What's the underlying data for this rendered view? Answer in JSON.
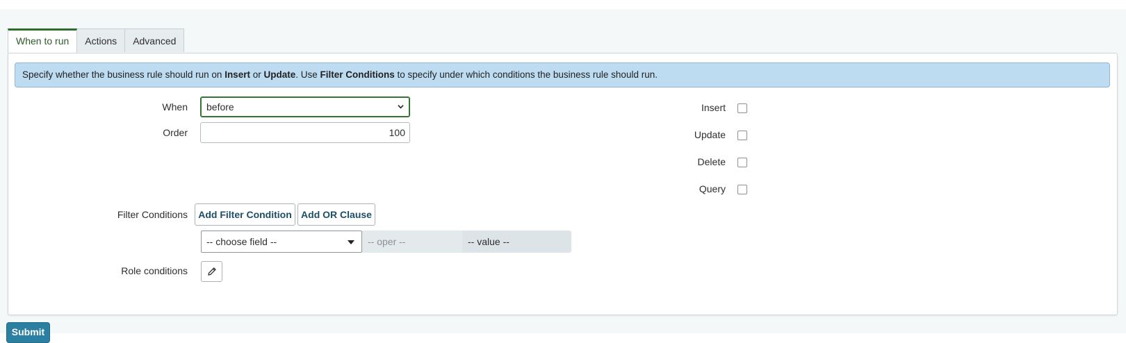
{
  "tabs": [
    {
      "label": "When to run",
      "active": true
    },
    {
      "label": "Actions",
      "active": false
    },
    {
      "label": "Advanced",
      "active": false
    }
  ],
  "info": {
    "part1": "Specify whether the business rule should run on ",
    "insert": "Insert",
    "or": " or ",
    "update": "Update",
    "part2": ". Use ",
    "filter": "Filter Conditions",
    "part3": " to specify under which conditions the business rule should run."
  },
  "form": {
    "when_label": "When",
    "when_value": "before",
    "order_label": "Order",
    "order_value": "100",
    "filter_label": "Filter Conditions",
    "add_filter_label": "Add Filter Condition",
    "add_or_label": "Add OR Clause",
    "choose_field": "-- choose field --",
    "oper": "-- oper --",
    "value": "-- value --",
    "role_label": "Role conditions"
  },
  "checkboxes": [
    {
      "label": "Insert",
      "checked": false
    },
    {
      "label": "Update",
      "checked": false
    },
    {
      "label": "Delete",
      "checked": false
    },
    {
      "label": "Query",
      "checked": false
    }
  ],
  "submit_label": "Submit",
  "colors": {
    "accent_green": "#2e6b2c",
    "info_bg": "#bedcf1",
    "submit_bg": "#2b7fa0"
  }
}
